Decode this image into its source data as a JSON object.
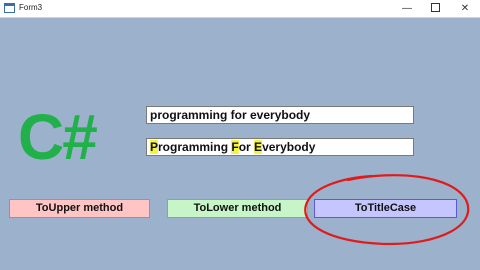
{
  "window": {
    "title": "Form3",
    "minimize_glyph": "—",
    "close_glyph": "✕"
  },
  "logo": {
    "text": "C#"
  },
  "inputs": {
    "original": "programming for everybody",
    "result_segments": [
      "P",
      "rogramming ",
      "F",
      "or ",
      "E",
      "verybody"
    ]
  },
  "buttons": {
    "upper": "ToUpper method",
    "lower": "ToLower method",
    "title_case": "ToTitleCase"
  },
  "colors": {
    "background": "#9bb1cc",
    "logo": "#22b04a",
    "highlight": "#f5f24a",
    "annotation_circle": "#e01b1b"
  },
  "icons": [
    "app-icon",
    "minimize-icon",
    "maximize-icon",
    "close-icon"
  ]
}
